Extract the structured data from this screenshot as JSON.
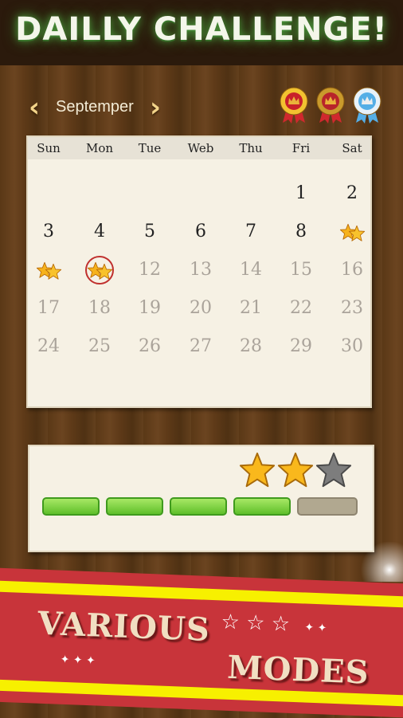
{
  "header": {
    "title": "DAILLY CHALLENGE!"
  },
  "calendar": {
    "month": "Septemper",
    "prev_icon": "chevron-left-icon",
    "next_icon": "chevron-right-icon",
    "medals": [
      {
        "color": "gold",
        "earned": true
      },
      {
        "color": "bronze",
        "earned": true
      },
      {
        "color": "silver",
        "earned": true
      }
    ],
    "weekdays": [
      "Sun",
      "Mon",
      "Tue",
      "Web",
      "Thu",
      "Fri",
      "Sat"
    ],
    "first_weekday": 5,
    "days": [
      "1",
      "2",
      "3",
      "4",
      "5",
      "6",
      "7",
      "8",
      "9",
      "10",
      "11",
      "12",
      "13",
      "14",
      "15",
      "16",
      "17",
      "18",
      "19",
      "20",
      "21",
      "22",
      "23",
      "24",
      "25",
      "26",
      "27",
      "28",
      "29",
      "30"
    ],
    "completed_days": [
      9,
      10,
      11
    ],
    "selected_day": 11,
    "last_available_day": 11
  },
  "progress": {
    "stars_earned": 2,
    "stars_total": 3,
    "segments_filled": 4,
    "segments_total": 5,
    "colors": {
      "filled": "#6cc832",
      "empty": "#b1a890",
      "star": "#f9b81c",
      "star_empty": "#7d7d7d"
    }
  },
  "banner": {
    "line1": "VARIOUS",
    "line2": "MODES",
    "colors": {
      "band": "#c8343a",
      "stripe": "#f7f000"
    }
  }
}
